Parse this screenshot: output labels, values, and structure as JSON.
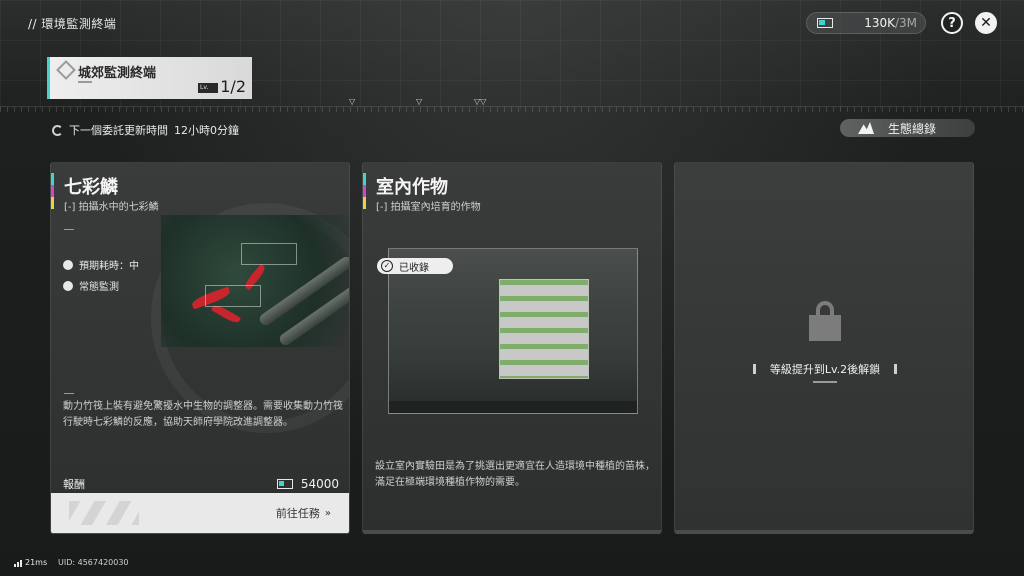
{
  "header": {
    "breadcrumb": "// 環境監測終端",
    "currency": {
      "amount": "130K",
      "cap": "/3M"
    },
    "help_label": "?",
    "close_label": "✕"
  },
  "terminal": {
    "name": "城郊監測終端",
    "lv_badge": "Lv.",
    "level": "1/2"
  },
  "refresh": {
    "label": "下一個委託更新時間",
    "time": "12小時0分鐘"
  },
  "eco_button": {
    "label": "生態總錄"
  },
  "cards": [
    {
      "title": "七彩鱗",
      "subtitle": "拍攝水中的七彩鱗",
      "meta": [
        {
          "label": "預期耗時：中"
        },
        {
          "label": "常態監測"
        }
      ],
      "description": "動力竹筏上裝有避免驚擾水中生物的調整器。需要收集動力竹筏行駛時七彩鱗的反應，協助天師府學院改進調整器。",
      "reward_label": "報酬",
      "reward_value": "54000",
      "goto_label": "前往任務",
      "goto_arrow": "»"
    },
    {
      "title": "室內作物",
      "subtitle": "拍攝室內培育的作物",
      "status": "已收錄",
      "description": "設立室內實驗田是為了挑選出更適宜在人造環境中種植的苗株，滿足在極端環境種植作物的需要。"
    },
    {
      "locked_text": "等級提升到Lv.2後解鎖"
    }
  ],
  "footer": {
    "ping": "21ms",
    "uid": "UID: 4567420030"
  },
  "colors": {
    "accent_teal": "#3fd5c8",
    "accent_magenta": "#d048c8",
    "accent_yellow": "#e6d43a",
    "fish_red": "#c8262c"
  }
}
